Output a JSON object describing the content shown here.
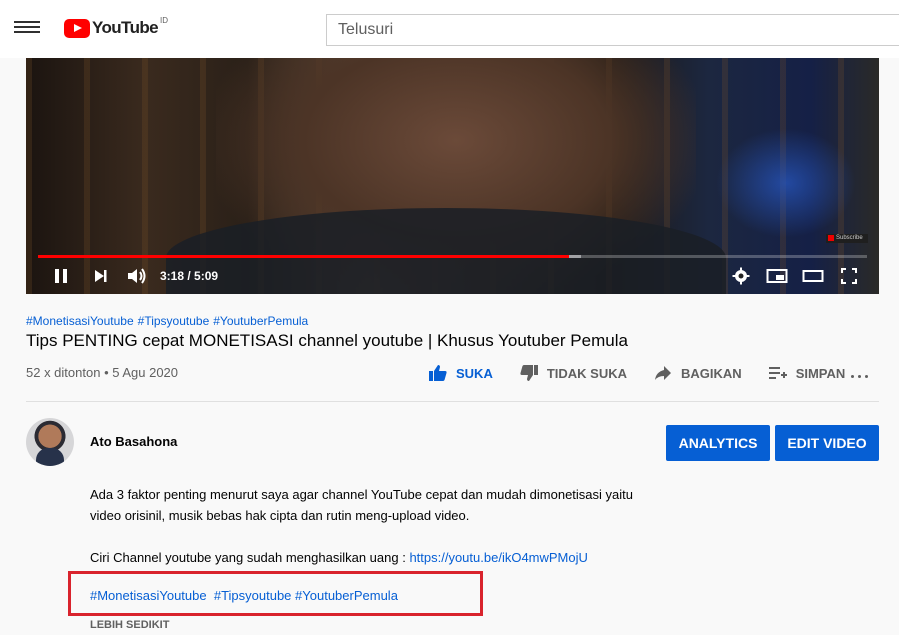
{
  "header": {
    "logo_text": "YouTube",
    "country_code": "ID",
    "search_placeholder": "Telusuri"
  },
  "player": {
    "time_current": "3:18",
    "time_separator": " / ",
    "time_total": "5:09",
    "played_fraction": 0.64,
    "buffered_fraction": 0.655,
    "subscribe_watermark": "Subscribe"
  },
  "video": {
    "hashtags": [
      "#MonetisasiYoutube",
      "#Tipsyoutube",
      "#YoutuberPemula"
    ],
    "title": "Tips PENTING cepat MONETISASI channel youtube | Khusus Youtuber Pemula",
    "views": "52 x ditonton",
    "separator": " • ",
    "date": "5 Agu 2020"
  },
  "actions": {
    "like": "SUKA",
    "dislike": "TIDAK SUKA",
    "share": "BAGIKAN",
    "save": "SIMPAN"
  },
  "channel": {
    "name": "Ato Basahona",
    "analytics_label": "ANALYTICS",
    "edit_label": "EDIT VIDEO"
  },
  "description": {
    "line1": "Ada 3 faktor penting menurut saya agar channel YouTube cepat dan mudah dimonetisasi yaitu",
    "line2": "video orisinil, musik bebas hak cipta dan rutin meng-upload video.",
    "line3_prefix": "Ciri Channel youtube yang sudah menghasilkan uang : ",
    "line3_link": "https://youtu.be/ikO4mwPMojU",
    "hashtags": [
      "#MonetisasiYoutube",
      "#Tipsyoutube",
      "#YoutuberPemula"
    ],
    "show_less": "LEBIH SEDIKIT"
  },
  "colors": {
    "accent_blue": "#065fd4",
    "progress_red": "#ff0000",
    "highlight_box": "#d9232d"
  }
}
